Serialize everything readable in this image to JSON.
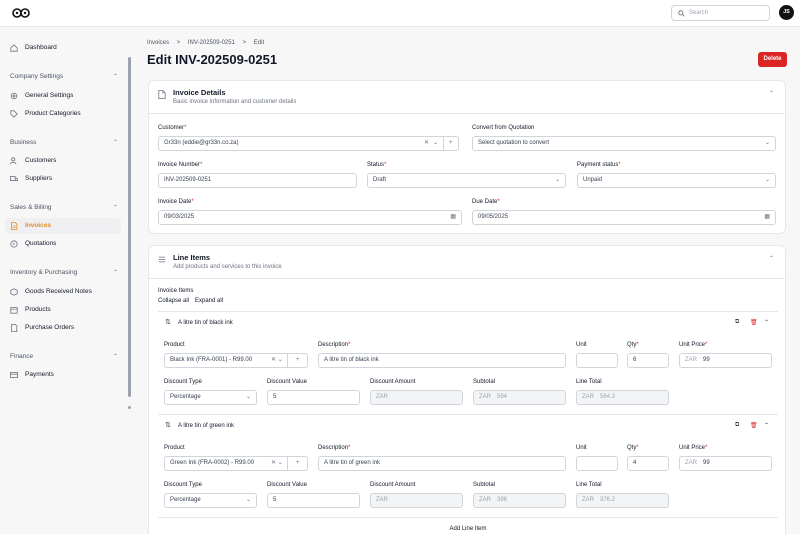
{
  "header": {
    "search_placeholder": "Search",
    "avatar_initials": "JS"
  },
  "sidebar": {
    "dashboard": "Dashboard",
    "company_settings": "Company Settings",
    "general_settings": "General Settings",
    "product_categories": "Product Categories",
    "business": "Business",
    "customers": "Customers",
    "suppliers": "Suppliers",
    "sales_billing": "Sales & Billing",
    "invoices": "Invoices",
    "quotations": "Quotations",
    "inventory_purchasing": "Inventory & Purchasing",
    "goods_received_notes": "Goods Received Notes",
    "products": "Products",
    "purchase_orders": "Purchase Orders",
    "finance": "Finance",
    "payments": "Payments"
  },
  "breadcrumb": {
    "root": "Invoices",
    "sep": ">",
    "invoice": "INV-202509-0251",
    "current": "Edit"
  },
  "page": {
    "title": "Edit INV-202509-0251",
    "delete_label": "Delete"
  },
  "details": {
    "title": "Invoice Details",
    "subtitle": "Basic invoice information and customer details",
    "customer_label": "Customer",
    "customer_value": "Gr33n (eddie@gr33n.co.za)",
    "convert_label": "Convert from Quotation",
    "convert_placeholder": "Select quotation to convert",
    "number_label": "Invoice Number",
    "number_value": "INV-202509-0251",
    "status_label": "Status",
    "status_value": "Draft",
    "payment_label": "Payment status",
    "payment_value": "Unpaid",
    "date_label": "Invoice Date",
    "date_value": "09/03/2025",
    "due_label": "Due Date",
    "due_value": "09/05/2025",
    "required_mark": "*"
  },
  "line_items": {
    "title": "Line Items",
    "subtitle": "Add products and services to this invoice",
    "section_label": "Invoice Items",
    "collapse_all": "Collapse all",
    "expand_all": "Expand all",
    "add_line_item": "Add Line Item",
    "labels": {
      "product": "Product",
      "description": "Description",
      "unit": "Unit",
      "qty": "Qty",
      "unit_price": "Unit Price",
      "discount_type": "Discount Type",
      "discount_value": "Discount Value",
      "discount_amount": "Discount Amount",
      "subtotal": "Subtotal",
      "line_total": "Line Total"
    },
    "items": [
      {
        "title": "A litre tin of black ink",
        "product": "Black Ink (FRA-0001) - R99.00",
        "description": "A litre tin of black ink",
        "unit": "",
        "qty": "6",
        "currency": "ZAR",
        "unit_price": "99",
        "discount_type": "Percentage",
        "discount_value": "5",
        "discount_amount": "",
        "subtotal": "594",
        "line_total": "564.3"
      },
      {
        "title": "A litre tin of green ink",
        "product": "Green Ink (FRA-0002) - R99.00",
        "description": "A litre tin of green ink",
        "unit": "",
        "qty": "4",
        "currency": "ZAR",
        "unit_price": "99",
        "discount_type": "Percentage",
        "discount_value": "5",
        "discount_amount": "",
        "subtotal": "396",
        "line_total": "376.2"
      }
    ]
  },
  "colors": {
    "accent": "#e88a1a",
    "danger": "#dc2626"
  }
}
